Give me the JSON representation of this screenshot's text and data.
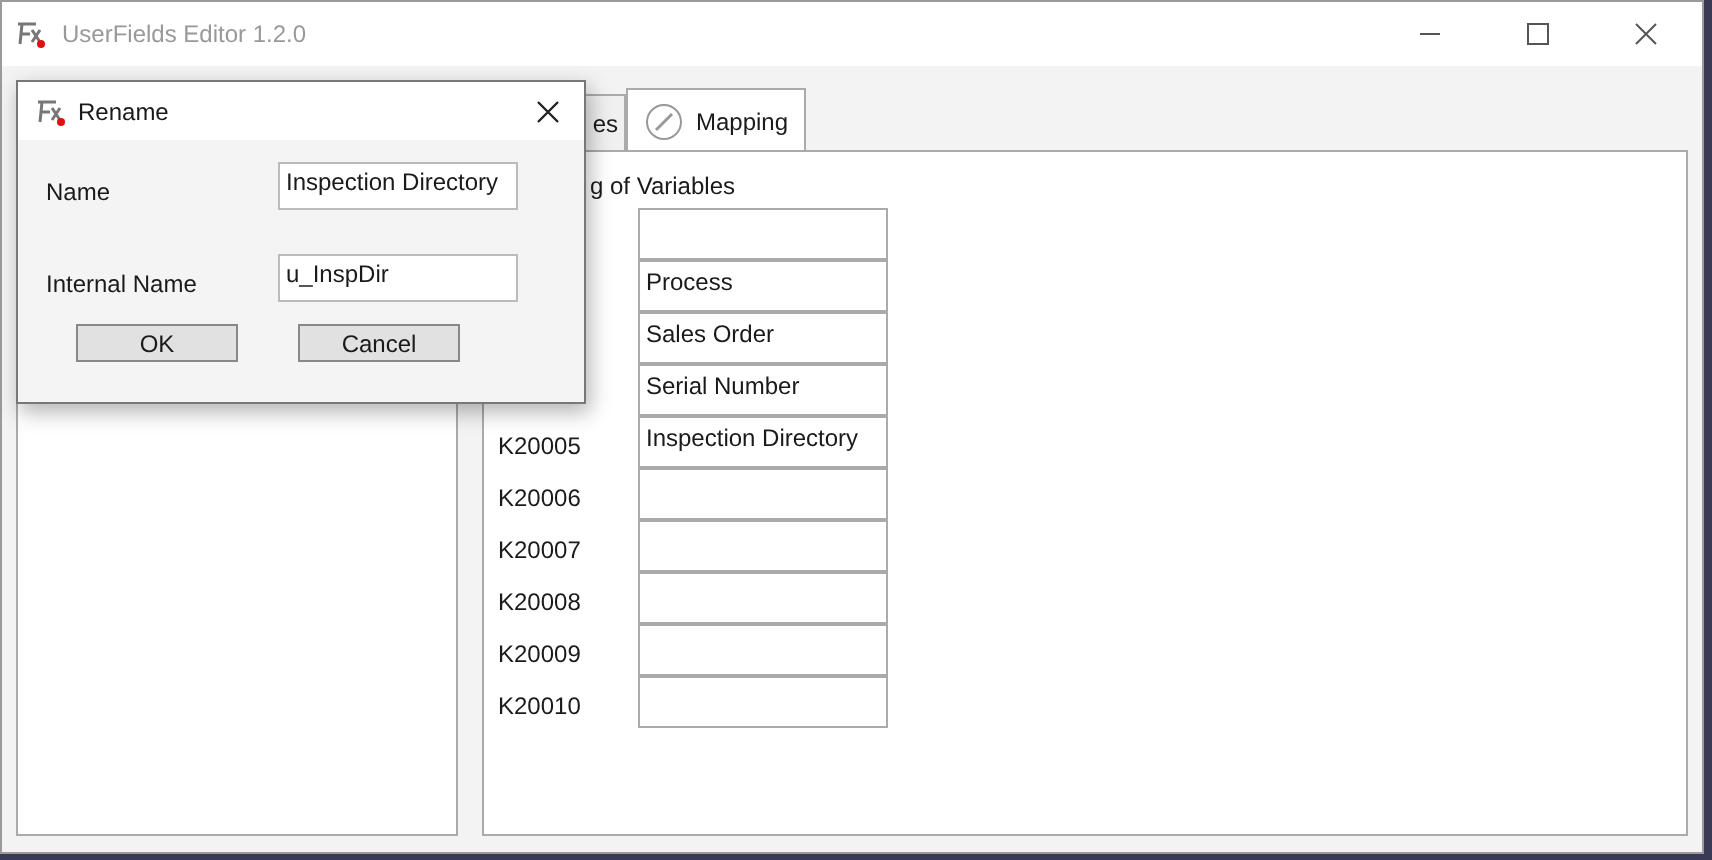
{
  "window": {
    "title": "UserFields Editor 1.2.0"
  },
  "tabs": [
    {
      "label": "es",
      "selected": false
    },
    {
      "label": "Mapping",
      "selected": true
    }
  ],
  "mapping": {
    "heading": "g of Variables",
    "rows": [
      {
        "value": ""
      },
      {
        "value": "Process"
      },
      {
        "value": "Sales Order"
      },
      {
        "value": "Serial Number"
      },
      {
        "key": "K20005",
        "value": "Inspection Directory"
      },
      {
        "key": "K20006",
        "value": ""
      },
      {
        "key": "K20007",
        "value": ""
      },
      {
        "key": "K20008",
        "value": ""
      },
      {
        "key": "K20009",
        "value": ""
      },
      {
        "key": "K20010",
        "value": ""
      }
    ]
  },
  "dialog": {
    "title": "Rename",
    "fields": [
      {
        "label": "Name",
        "value": "Inspection Directory"
      },
      {
        "label": "Internal Name",
        "value": "u_InspDir"
      }
    ],
    "buttons": [
      "OK",
      "Cancel"
    ]
  }
}
